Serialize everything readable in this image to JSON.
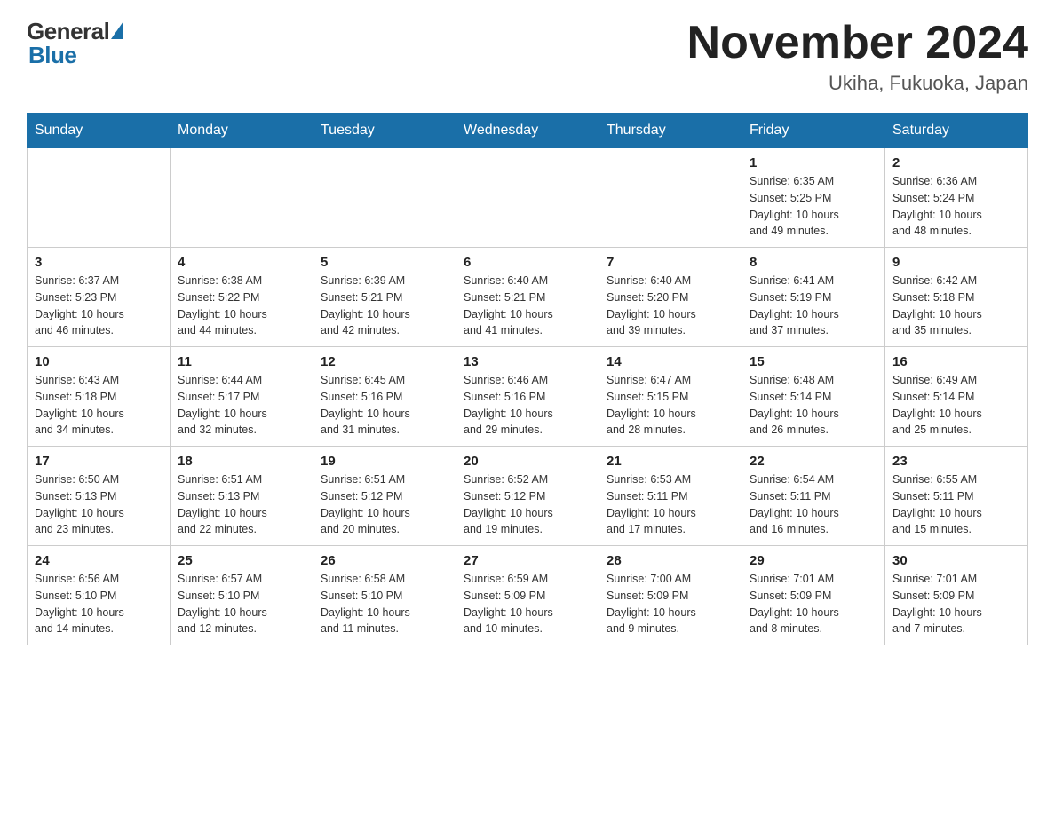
{
  "header": {
    "logo_general": "General",
    "logo_blue": "Blue",
    "month_title": "November 2024",
    "location": "Ukiha, Fukuoka, Japan"
  },
  "weekdays": [
    "Sunday",
    "Monday",
    "Tuesday",
    "Wednesday",
    "Thursday",
    "Friday",
    "Saturday"
  ],
  "weeks": [
    [
      {
        "day": "",
        "info": ""
      },
      {
        "day": "",
        "info": ""
      },
      {
        "day": "",
        "info": ""
      },
      {
        "day": "",
        "info": ""
      },
      {
        "day": "",
        "info": ""
      },
      {
        "day": "1",
        "info": "Sunrise: 6:35 AM\nSunset: 5:25 PM\nDaylight: 10 hours\nand 49 minutes."
      },
      {
        "day": "2",
        "info": "Sunrise: 6:36 AM\nSunset: 5:24 PM\nDaylight: 10 hours\nand 48 minutes."
      }
    ],
    [
      {
        "day": "3",
        "info": "Sunrise: 6:37 AM\nSunset: 5:23 PM\nDaylight: 10 hours\nand 46 minutes."
      },
      {
        "day": "4",
        "info": "Sunrise: 6:38 AM\nSunset: 5:22 PM\nDaylight: 10 hours\nand 44 minutes."
      },
      {
        "day": "5",
        "info": "Sunrise: 6:39 AM\nSunset: 5:21 PM\nDaylight: 10 hours\nand 42 minutes."
      },
      {
        "day": "6",
        "info": "Sunrise: 6:40 AM\nSunset: 5:21 PM\nDaylight: 10 hours\nand 41 minutes."
      },
      {
        "day": "7",
        "info": "Sunrise: 6:40 AM\nSunset: 5:20 PM\nDaylight: 10 hours\nand 39 minutes."
      },
      {
        "day": "8",
        "info": "Sunrise: 6:41 AM\nSunset: 5:19 PM\nDaylight: 10 hours\nand 37 minutes."
      },
      {
        "day": "9",
        "info": "Sunrise: 6:42 AM\nSunset: 5:18 PM\nDaylight: 10 hours\nand 35 minutes."
      }
    ],
    [
      {
        "day": "10",
        "info": "Sunrise: 6:43 AM\nSunset: 5:18 PM\nDaylight: 10 hours\nand 34 minutes."
      },
      {
        "day": "11",
        "info": "Sunrise: 6:44 AM\nSunset: 5:17 PM\nDaylight: 10 hours\nand 32 minutes."
      },
      {
        "day": "12",
        "info": "Sunrise: 6:45 AM\nSunset: 5:16 PM\nDaylight: 10 hours\nand 31 minutes."
      },
      {
        "day": "13",
        "info": "Sunrise: 6:46 AM\nSunset: 5:16 PM\nDaylight: 10 hours\nand 29 minutes."
      },
      {
        "day": "14",
        "info": "Sunrise: 6:47 AM\nSunset: 5:15 PM\nDaylight: 10 hours\nand 28 minutes."
      },
      {
        "day": "15",
        "info": "Sunrise: 6:48 AM\nSunset: 5:14 PM\nDaylight: 10 hours\nand 26 minutes."
      },
      {
        "day": "16",
        "info": "Sunrise: 6:49 AM\nSunset: 5:14 PM\nDaylight: 10 hours\nand 25 minutes."
      }
    ],
    [
      {
        "day": "17",
        "info": "Sunrise: 6:50 AM\nSunset: 5:13 PM\nDaylight: 10 hours\nand 23 minutes."
      },
      {
        "day": "18",
        "info": "Sunrise: 6:51 AM\nSunset: 5:13 PM\nDaylight: 10 hours\nand 22 minutes."
      },
      {
        "day": "19",
        "info": "Sunrise: 6:51 AM\nSunset: 5:12 PM\nDaylight: 10 hours\nand 20 minutes."
      },
      {
        "day": "20",
        "info": "Sunrise: 6:52 AM\nSunset: 5:12 PM\nDaylight: 10 hours\nand 19 minutes."
      },
      {
        "day": "21",
        "info": "Sunrise: 6:53 AM\nSunset: 5:11 PM\nDaylight: 10 hours\nand 17 minutes."
      },
      {
        "day": "22",
        "info": "Sunrise: 6:54 AM\nSunset: 5:11 PM\nDaylight: 10 hours\nand 16 minutes."
      },
      {
        "day": "23",
        "info": "Sunrise: 6:55 AM\nSunset: 5:11 PM\nDaylight: 10 hours\nand 15 minutes."
      }
    ],
    [
      {
        "day": "24",
        "info": "Sunrise: 6:56 AM\nSunset: 5:10 PM\nDaylight: 10 hours\nand 14 minutes."
      },
      {
        "day": "25",
        "info": "Sunrise: 6:57 AM\nSunset: 5:10 PM\nDaylight: 10 hours\nand 12 minutes."
      },
      {
        "day": "26",
        "info": "Sunrise: 6:58 AM\nSunset: 5:10 PM\nDaylight: 10 hours\nand 11 minutes."
      },
      {
        "day": "27",
        "info": "Sunrise: 6:59 AM\nSunset: 5:09 PM\nDaylight: 10 hours\nand 10 minutes."
      },
      {
        "day": "28",
        "info": "Sunrise: 7:00 AM\nSunset: 5:09 PM\nDaylight: 10 hours\nand 9 minutes."
      },
      {
        "day": "29",
        "info": "Sunrise: 7:01 AM\nSunset: 5:09 PM\nDaylight: 10 hours\nand 8 minutes."
      },
      {
        "day": "30",
        "info": "Sunrise: 7:01 AM\nSunset: 5:09 PM\nDaylight: 10 hours\nand 7 minutes."
      }
    ]
  ]
}
